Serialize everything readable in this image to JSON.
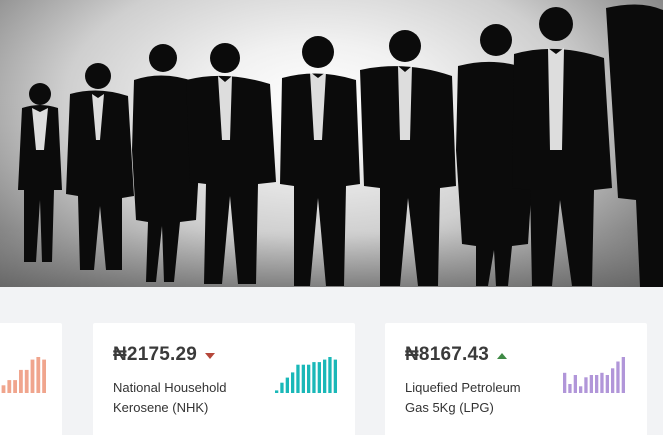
{
  "products": [
    {
      "price": "",
      "name": "",
      "trend": "none",
      "color": "#f0a58d",
      "spark": [
        2,
        3,
        3,
        5,
        5,
        9,
        9,
        13,
        14,
        13
      ]
    },
    {
      "price": "₦2175.29",
      "name": "National Household Kerosene (NHK)",
      "trend": "down",
      "color": "#1ab8b8",
      "spark": [
        1,
        4,
        6,
        8,
        11,
        11,
        11,
        12,
        12,
        13,
        14,
        13
      ]
    },
    {
      "price": "₦8167.43",
      "name": "Liquefied Petroleum Gas 5Kg (LPG)",
      "trend": "up",
      "color": "#b196d9",
      "spark": [
        9,
        4,
        8,
        3,
        7,
        8,
        8,
        9,
        8,
        11,
        14,
        16
      ]
    }
  ]
}
